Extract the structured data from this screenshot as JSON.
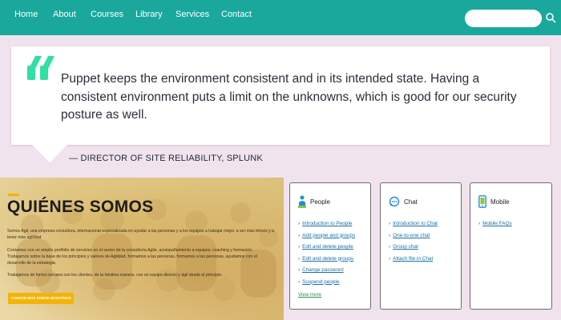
{
  "nav": {
    "items": [
      "Home",
      "About",
      "Courses",
      "Library",
      "Services",
      "Contact"
    ],
    "search_placeholder": ""
  },
  "quote": {
    "text": "Puppet keeps the environment consistent and in its intended state. Having a consistent environment puts a limit on the unknowns, which is good for our security posture as well.",
    "attribution": "— DIRECTOR OF SITE RELIABILITY, SPLUNK"
  },
  "about": {
    "title": "QUIÉNES SOMOS",
    "paragraphs": [
      "Somos Agil, una empresa consultora, internacional especializada en ayudar a las personas y a los equipos a trabajar mejor, a ser más felices y a tener más agilidad",
      "Contamos con un amplio portfolio de servicios en el sector de la consultoría Agile, acompañamiento a equipos, coaching y formación. Trabajamos sobre la base de los principios y valores de Agilidad, formamos a las personas, formamos a las personas, ayudamos con el desarrollo de la estrategia.",
      "Trabajamos de forma cercana con los clientes, de la intuitiva manera, con un equipo diverso y ágil desde el principio."
    ],
    "button_label": "CONOCE MÁS SOBRE NOSOTROS"
  },
  "cards": [
    {
      "title": "People",
      "icon": "people-icon",
      "links": [
        "Introduction to People",
        "Add people and groups",
        "Edit and delete people",
        "Edit and delete groups",
        "Change password",
        "Suspend people"
      ],
      "view_more": "View more"
    },
    {
      "title": "Chat",
      "icon": "chat-icon",
      "links": [
        "Introduction to Chat",
        "One-to-one chat",
        "Group chat",
        "Attach file in Chat"
      ],
      "view_more": ""
    },
    {
      "title": "Mobile",
      "icon": "mobile-icon",
      "links": [
        "Mobile FAQs"
      ],
      "view_more": ""
    }
  ],
  "colors": {
    "nav_bg": "#1aa89c",
    "page_bg": "#f0e3ee",
    "quote_mark": "#2fe0a0",
    "accent_yellow": "#f2b409",
    "link_blue": "#1a6fa8"
  }
}
